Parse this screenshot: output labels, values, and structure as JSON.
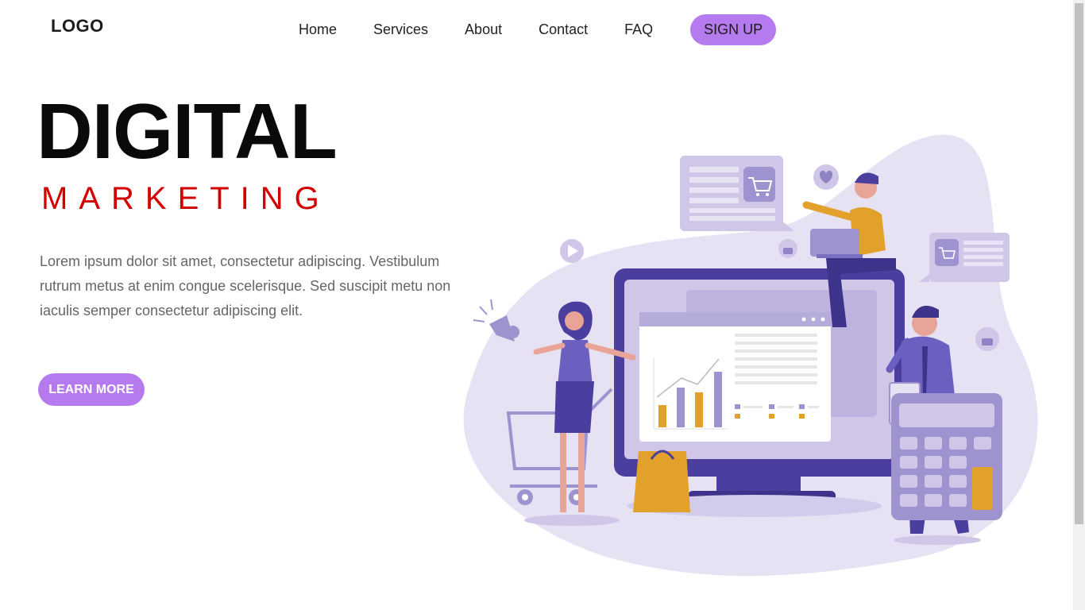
{
  "header": {
    "logo": "LOGO",
    "nav": [
      "Home",
      "Services",
      "About",
      "Contact",
      "FAQ"
    ],
    "signup_label": "SIGN UP"
  },
  "hero": {
    "title": "DIGITAL",
    "subtitle": "MARKETING",
    "description": "Lorem ipsum dolor sit amet, consectetur adipiscing. Vestibulum rutrum metus at enim congue scelerisque. Sed suscipit metu non iaculis semper consectetur adipiscing elit.",
    "button_label": "LEARN MORE"
  },
  "colors": {
    "accent": "#b57bee",
    "subtitle": "#d40000",
    "illustration_purple": "#4a3f9e",
    "illustration_light": "#e6e1f3",
    "illustration_orange": "#e2a12a"
  },
  "icons": [
    "cart-icon",
    "heart-icon",
    "play-icon",
    "thumbs-up-icon",
    "megaphone-icon"
  ]
}
